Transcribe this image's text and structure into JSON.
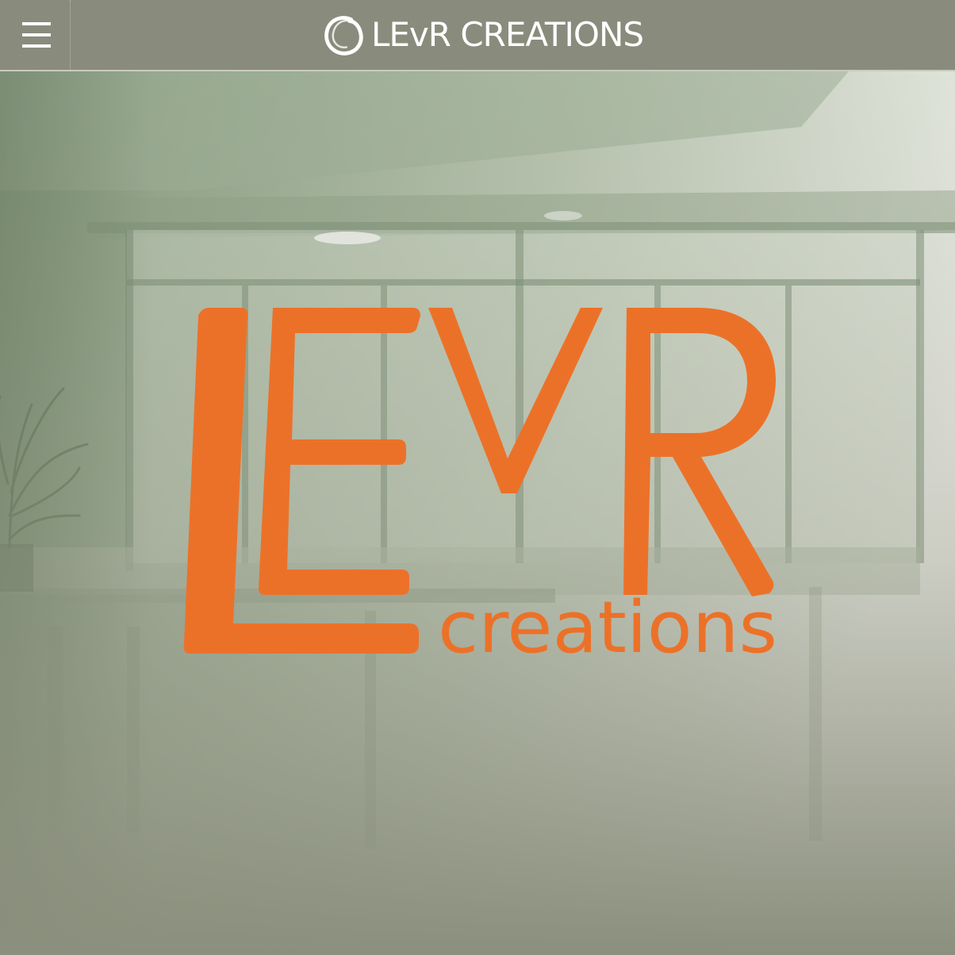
{
  "header": {
    "menu_icon": "hamburger-menu-icon",
    "brand_icon": "enso-circle-icon",
    "brand_text": "LEvR CREATIONS"
  },
  "hero": {
    "background": "office-interior-photo",
    "logo": {
      "letter_l": "L",
      "letter_e": "E",
      "letter_v": "V",
      "letter_r": "R",
      "subtitle": "creations",
      "color": "#ec7128"
    }
  },
  "colors": {
    "header_bg": "#898c7c",
    "accent": "#ec7128",
    "text_light": "#ffffff"
  }
}
